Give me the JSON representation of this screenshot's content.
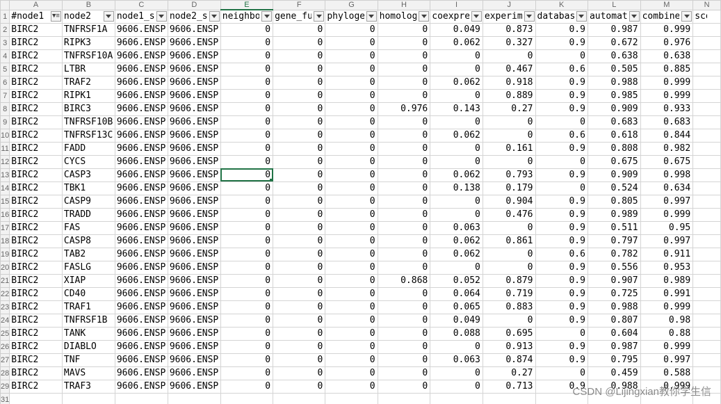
{
  "columns": [
    "A",
    "B",
    "C",
    "D",
    "E",
    "F",
    "G",
    "H",
    "I",
    "J",
    "K",
    "L",
    "M",
    "N"
  ],
  "selected_column": "E",
  "headers": [
    "#node1",
    "node2",
    "node1_s",
    "node2_s",
    "neighbo",
    "gene_fu",
    "phyloge",
    "homolog",
    "coexpre",
    "experim",
    "databas",
    "automat",
    "combine",
    "score"
  ],
  "active_cell": {
    "row": 13,
    "col": 4
  },
  "partial_last_row_label": "31",
  "rows": [
    {
      "n": "2",
      "cells": [
        "BIRC2",
        "TNFRSF1A",
        "9606.ENSP",
        "9606.ENSP",
        "0",
        "0",
        "0",
        "0",
        "0.049",
        "0.873",
        "0.9",
        "0.987",
        "0.999"
      ]
    },
    {
      "n": "3",
      "cells": [
        "BIRC2",
        "RIPK3",
        "9606.ENSP",
        "9606.ENSP",
        "0",
        "0",
        "0",
        "0",
        "0.062",
        "0.327",
        "0.9",
        "0.672",
        "0.976"
      ]
    },
    {
      "n": "4",
      "cells": [
        "BIRC2",
        "TNFRSF10A",
        "9606.ENSP",
        "9606.ENSP",
        "0",
        "0",
        "0",
        "0",
        "0",
        "0",
        "0",
        "0.638",
        "0.638"
      ]
    },
    {
      "n": "5",
      "cells": [
        "BIRC2",
        "LTBR",
        "9606.ENSP",
        "9606.ENSP",
        "0",
        "0",
        "0",
        "0",
        "0",
        "0.467",
        "0.6",
        "0.505",
        "0.885"
      ]
    },
    {
      "n": "6",
      "cells": [
        "BIRC2",
        "TRAF2",
        "9606.ENSP",
        "9606.ENSP",
        "0",
        "0",
        "0",
        "0",
        "0.062",
        "0.918",
        "0.9",
        "0.988",
        "0.999"
      ]
    },
    {
      "n": "7",
      "cells": [
        "BIRC2",
        "RIPK1",
        "9606.ENSP",
        "9606.ENSP",
        "0",
        "0",
        "0",
        "0",
        "0",
        "0.889",
        "0.9",
        "0.985",
        "0.999"
      ]
    },
    {
      "n": "8",
      "cells": [
        "BIRC2",
        "BIRC3",
        "9606.ENSP",
        "9606.ENSP",
        "0",
        "0",
        "0",
        "0.976",
        "0.143",
        "0.27",
        "0.9",
        "0.909",
        "0.933"
      ]
    },
    {
      "n": "9",
      "cells": [
        "BIRC2",
        "TNFRSF10B",
        "9606.ENSP",
        "9606.ENSP",
        "0",
        "0",
        "0",
        "0",
        "0",
        "0",
        "0",
        "0.683",
        "0.683"
      ]
    },
    {
      "n": "10",
      "cells": [
        "BIRC2",
        "TNFRSF13C",
        "9606.ENSP",
        "9606.ENSP",
        "0",
        "0",
        "0",
        "0",
        "0.062",
        "0",
        "0.6",
        "0.618",
        "0.844"
      ]
    },
    {
      "n": "11",
      "cells": [
        "BIRC2",
        "FADD",
        "9606.ENSP",
        "9606.ENSP",
        "0",
        "0",
        "0",
        "0",
        "0",
        "0.161",
        "0.9",
        "0.808",
        "0.982"
      ]
    },
    {
      "n": "12",
      "cells": [
        "BIRC2",
        "CYCS",
        "9606.ENSP",
        "9606.ENSP",
        "0",
        "0",
        "0",
        "0",
        "0",
        "0",
        "0",
        "0.675",
        "0.675"
      ]
    },
    {
      "n": "13",
      "cells": [
        "BIRC2",
        "CASP3",
        "9606.ENSP",
        "9606.ENSP",
        "0",
        "0",
        "0",
        "0",
        "0.062",
        "0.793",
        "0.9",
        "0.909",
        "0.998"
      ]
    },
    {
      "n": "14",
      "cells": [
        "BIRC2",
        "TBK1",
        "9606.ENSP",
        "9606.ENSP",
        "0",
        "0",
        "0",
        "0",
        "0.138",
        "0.179",
        "0",
        "0.524",
        "0.634"
      ]
    },
    {
      "n": "15",
      "cells": [
        "BIRC2",
        "CASP9",
        "9606.ENSP",
        "9606.ENSP",
        "0",
        "0",
        "0",
        "0",
        "0",
        "0.904",
        "0.9",
        "0.805",
        "0.997"
      ]
    },
    {
      "n": "16",
      "cells": [
        "BIRC2",
        "TRADD",
        "9606.ENSP",
        "9606.ENSP",
        "0",
        "0",
        "0",
        "0",
        "0",
        "0.476",
        "0.9",
        "0.989",
        "0.999"
      ]
    },
    {
      "n": "17",
      "cells": [
        "BIRC2",
        "FAS",
        "9606.ENSP",
        "9606.ENSP",
        "0",
        "0",
        "0",
        "0",
        "0.063",
        "0",
        "0.9",
        "0.511",
        "0.95"
      ]
    },
    {
      "n": "18",
      "cells": [
        "BIRC2",
        "CASP8",
        "9606.ENSP",
        "9606.ENSP",
        "0",
        "0",
        "0",
        "0",
        "0.062",
        "0.861",
        "0.9",
        "0.797",
        "0.997"
      ]
    },
    {
      "n": "19",
      "cells": [
        "BIRC2",
        "TAB2",
        "9606.ENSP",
        "9606.ENSP",
        "0",
        "0",
        "0",
        "0",
        "0.062",
        "0",
        "0.6",
        "0.782",
        "0.911"
      ]
    },
    {
      "n": "20",
      "cells": [
        "BIRC2",
        "FASLG",
        "9606.ENSP",
        "9606.ENSP",
        "0",
        "0",
        "0",
        "0",
        "0",
        "0",
        "0.9",
        "0.556",
        "0.953"
      ]
    },
    {
      "n": "21",
      "cells": [
        "BIRC2",
        "XIAP",
        "9606.ENSP",
        "9606.ENSP",
        "0",
        "0",
        "0",
        "0.868",
        "0.052",
        "0.879",
        "0.9",
        "0.907",
        "0.989"
      ]
    },
    {
      "n": "22",
      "cells": [
        "BIRC2",
        "CD40",
        "9606.ENSP",
        "9606.ENSP",
        "0",
        "0",
        "0",
        "0",
        "0.064",
        "0.719",
        "0.9",
        "0.725",
        "0.991"
      ]
    },
    {
      "n": "23",
      "cells": [
        "BIRC2",
        "TRAF1",
        "9606.ENSP",
        "9606.ENSP",
        "0",
        "0",
        "0",
        "0",
        "0.065",
        "0.883",
        "0.9",
        "0.988",
        "0.999"
      ]
    },
    {
      "n": "24",
      "cells": [
        "BIRC2",
        "TNFRSF1B",
        "9606.ENSP",
        "9606.ENSP",
        "0",
        "0",
        "0",
        "0",
        "0.049",
        "0",
        "0.9",
        "0.807",
        "0.98"
      ]
    },
    {
      "n": "25",
      "cells": [
        "BIRC2",
        "TANK",
        "9606.ENSP",
        "9606.ENSP",
        "0",
        "0",
        "0",
        "0",
        "0.088",
        "0.695",
        "0",
        "0.604",
        "0.88"
      ]
    },
    {
      "n": "26",
      "cells": [
        "BIRC2",
        "DIABLO",
        "9606.ENSP",
        "9606.ENSP",
        "0",
        "0",
        "0",
        "0",
        "0",
        "0.913",
        "0.9",
        "0.987",
        "0.999"
      ]
    },
    {
      "n": "27",
      "cells": [
        "BIRC2",
        "TNF",
        "9606.ENSP",
        "9606.ENSP",
        "0",
        "0",
        "0",
        "0",
        "0.063",
        "0.874",
        "0.9",
        "0.795",
        "0.997"
      ]
    },
    {
      "n": "28",
      "cells": [
        "BIRC2",
        "MAVS",
        "9606.ENSP",
        "9606.ENSP",
        "0",
        "0",
        "0",
        "0",
        "0",
        "0.27",
        "0",
        "0.459",
        "0.588"
      ]
    },
    {
      "n": "29",
      "cells": [
        "BIRC2",
        "TRAF3",
        "9606.ENSP",
        "9606.ENSP",
        "0",
        "0",
        "0",
        "0",
        "0",
        "0.713",
        "0.9",
        "0.988",
        "0.999"
      ]
    }
  ],
  "watermark": "CSDN @Lijingxian教你学生信"
}
